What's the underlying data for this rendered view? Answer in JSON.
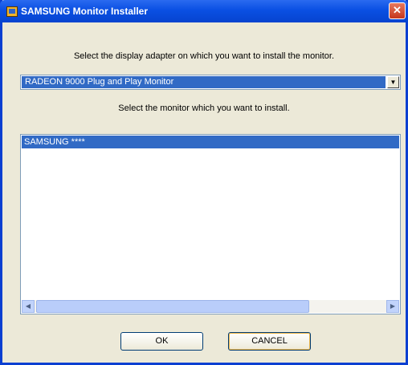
{
  "window": {
    "title": "SAMSUNG Monitor Installer",
    "close_glyph": "✕"
  },
  "instructions": {
    "select_adapter": "Select the display adapter on which you want to install the monitor.",
    "select_monitor": "Select the monitor which you want to install."
  },
  "adapter_combo": {
    "selected_value": "RADEON 9000 Plug and Play Monitor",
    "arrow_glyph": "▼"
  },
  "monitor_list": {
    "items": [
      {
        "label": "SAMSUNG ****",
        "selected": true
      }
    ],
    "scroll_left_glyph": "◀",
    "scroll_right_glyph": "▶"
  },
  "buttons": {
    "ok_label": "OK",
    "cancel_label": "CANCEL"
  },
  "colors": {
    "titlebar": "#0a50e3",
    "selection": "#316ac5",
    "dialog_face": "#ece9d8",
    "close_button": "#c6361c"
  },
  "icons": {
    "title": "monitor-installer-icon"
  }
}
